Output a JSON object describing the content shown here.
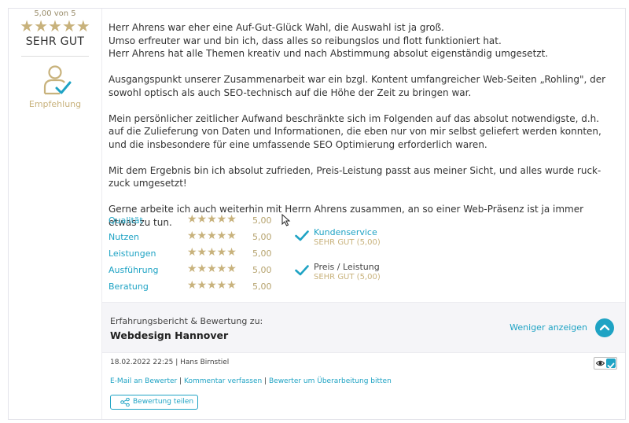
{
  "summary": {
    "score_text": "5,00 von 5",
    "stars": "★★★★★",
    "verdict": "SEHR GUT",
    "recommendation_label": "Empfehlung"
  },
  "review": {
    "paragraphs": [
      "Herr Ahrens war eher eine Auf-Gut-Glück Wahl, die Auswahl ist ja groß.\nUmso erfreuter war und bin ich, dass alles so reibungslos und flott funktioniert hat.\nHerr Ahrens hat alle Themen kreativ und nach Abstimmung absolut eigenständig umgesetzt.",
      "Ausgangspunkt unserer Zusammenarbeit war ein bzgl. Kontent umfangreicher Web-Seiten „Rohling\", der sowohl optisch als auch SEO-technisch auf die Höhe der Zeit zu bringen war.",
      "Mein persönlicher zeitlicher Aufwand beschränkte sich im Folgenden auf das absolut notwendigste, d.h. auf die Zulieferung von Daten und Informationen, die eben nur von mir selbst geliefert werden konnten, und die insbesondere für eine umfassende SEO Optimierung erforderlich waren.",
      "Mit dem Ergebnis bin ich absolut zufrieden, Preis-Leistung passt aus meiner Sicht, und alles wurde ruck-zuck umgesetzt!",
      "Gerne arbeite ich auch weiterhin mit Herrn Ahrens zusammen, an so einer Web-Präsenz ist ja immer etwas zu tun."
    ]
  },
  "ratings": [
    {
      "label": "Qualität",
      "stars": "★★★★★",
      "value": "5,00"
    },
    {
      "label": "Nutzen",
      "stars": "★★★★★",
      "value": "5,00"
    },
    {
      "label": "Leistungen",
      "stars": "★★★★★",
      "value": "5,00"
    },
    {
      "label": "Ausführung",
      "stars": "★★★★★",
      "value": "5,00"
    },
    {
      "label": "Beratung",
      "stars": "★★★★★",
      "value": "5,00"
    }
  ],
  "checks": [
    {
      "title": "Kundenservice",
      "sub": "SEHR GUT (5,00)",
      "title_color": "#1fa3c4"
    },
    {
      "title": "Preis / Leistung",
      "sub": "SEHR GUT (5,00)",
      "title_color": "#444444"
    }
  ],
  "context": {
    "subtitle": "Erfahrungsbericht & Bewertung zu:",
    "title": "Webdesign Hannover",
    "toggle_label": "Weniger anzeigen"
  },
  "footer": {
    "meta": "18.02.2022 22:25 | Hans Birnstiel",
    "link_email": "E-Mail an Bewerter",
    "link_comment": "Kommentar verfassen",
    "link_revise": "Bewerter um Überarbeitung bitten",
    "separator": " | ",
    "share_label": "Bewertung teilen"
  },
  "colors": {
    "accent": "#1fa3c4",
    "gold": "#c8b27c"
  }
}
